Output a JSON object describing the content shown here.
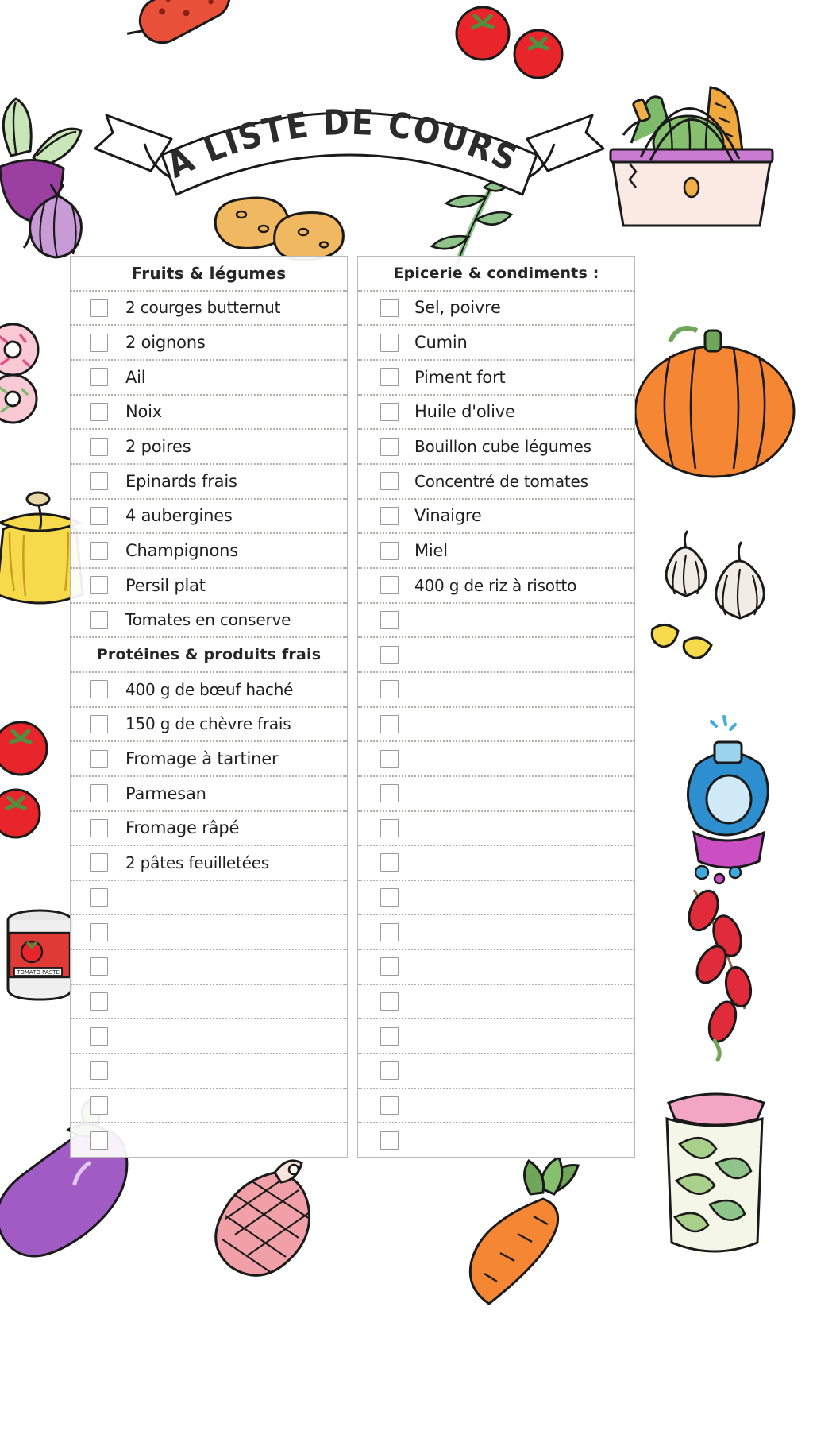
{
  "title": "MA LISTE DE COURSES",
  "columns": {
    "left": {
      "rows": [
        {
          "type": "header",
          "label": "Fruits & légumes"
        },
        {
          "type": "item",
          "label": "2 courges butternut"
        },
        {
          "type": "item",
          "label": "2 oignons"
        },
        {
          "type": "item",
          "label": "Ail"
        },
        {
          "type": "item",
          "label": "Noix"
        },
        {
          "type": "item",
          "label": "2 poires"
        },
        {
          "type": "item",
          "label": "Epinards frais"
        },
        {
          "type": "item",
          "label": "4 aubergines"
        },
        {
          "type": "item",
          "label": "Champignons"
        },
        {
          "type": "item",
          "label": "Persil plat"
        },
        {
          "type": "item",
          "label": "Tomates en conserve"
        },
        {
          "type": "header",
          "label": "Protéines & produits frais"
        },
        {
          "type": "item",
          "label": "400 g de bœuf haché"
        },
        {
          "type": "item",
          "label": "150 g de chèvre frais"
        },
        {
          "type": "item",
          "label": "Fromage à tartiner"
        },
        {
          "type": "item",
          "label": "Parmesan"
        },
        {
          "type": "item",
          "label": "Fromage râpé"
        },
        {
          "type": "item",
          "label": "2 pâtes feuilletées"
        },
        {
          "type": "item",
          "label": ""
        },
        {
          "type": "item",
          "label": ""
        },
        {
          "type": "item",
          "label": ""
        },
        {
          "type": "item",
          "label": ""
        },
        {
          "type": "item",
          "label": ""
        },
        {
          "type": "item",
          "label": ""
        },
        {
          "type": "item",
          "label": ""
        },
        {
          "type": "item",
          "label": ""
        }
      ]
    },
    "right": {
      "rows": [
        {
          "type": "header",
          "label": "Epicerie & condiments :"
        },
        {
          "type": "item",
          "label": "Sel, poivre"
        },
        {
          "type": "item",
          "label": "Cumin"
        },
        {
          "type": "item",
          "label": "Piment fort"
        },
        {
          "type": "item",
          "label": "Huile d'olive"
        },
        {
          "type": "item",
          "label": "Bouillon cube légumes"
        },
        {
          "type": "item",
          "label": "Concentré de tomates"
        },
        {
          "type": "item",
          "label": "Vinaigre"
        },
        {
          "type": "item",
          "label": "Miel"
        },
        {
          "type": "item",
          "label": "400 g de riz à risotto"
        },
        {
          "type": "item",
          "label": ""
        },
        {
          "type": "item",
          "label": ""
        },
        {
          "type": "item",
          "label": ""
        },
        {
          "type": "item",
          "label": ""
        },
        {
          "type": "item",
          "label": ""
        },
        {
          "type": "item",
          "label": ""
        },
        {
          "type": "item",
          "label": ""
        },
        {
          "type": "item",
          "label": ""
        },
        {
          "type": "item",
          "label": ""
        },
        {
          "type": "item",
          "label": ""
        },
        {
          "type": "item",
          "label": ""
        },
        {
          "type": "item",
          "label": ""
        },
        {
          "type": "item",
          "label": ""
        },
        {
          "type": "item",
          "label": ""
        },
        {
          "type": "item",
          "label": ""
        },
        {
          "type": "item",
          "label": ""
        }
      ]
    }
  },
  "decorations": [
    {
      "name": "sausage-illustration",
      "color": "#E8503A"
    },
    {
      "name": "tomato-illustration",
      "color": "#E8252B"
    },
    {
      "name": "grocery-basket-illustration",
      "color": "#FBE9E4"
    },
    {
      "name": "beet-illustration",
      "color": "#9B3FA0"
    },
    {
      "name": "onion-illustration",
      "color": "#B87FC4"
    },
    {
      "name": "potato-illustration",
      "color": "#F0B861"
    },
    {
      "name": "herb-illustration",
      "color": "#8FC48A"
    },
    {
      "name": "pumpkin-illustration",
      "color": "#F58634"
    },
    {
      "name": "donut-illustration",
      "color": "#F9C9D4"
    },
    {
      "name": "honey-jar-illustration",
      "color": "#F7D94C"
    },
    {
      "name": "garlic-illustration",
      "color": "#EFEAE4"
    },
    {
      "name": "tomato-paste-can-illustration",
      "color": "#E03A36"
    },
    {
      "name": "detergent-bottle-illustration",
      "color": "#3FA9E0"
    },
    {
      "name": "chili-string-illustration",
      "color": "#E02B3A"
    },
    {
      "name": "eggplant-illustration",
      "color": "#A05BC4"
    },
    {
      "name": "ham-illustration",
      "color": "#F2A0A8"
    },
    {
      "name": "carrot-illustration",
      "color": "#F58634"
    },
    {
      "name": "pickle-jar-illustration",
      "color": "#A9D08A"
    }
  ],
  "colors": {
    "text": "#1f1f1f",
    "rule": "#b0aca8",
    "border": "#b9b9b9",
    "checkbox_border": "#9a9a9a"
  }
}
